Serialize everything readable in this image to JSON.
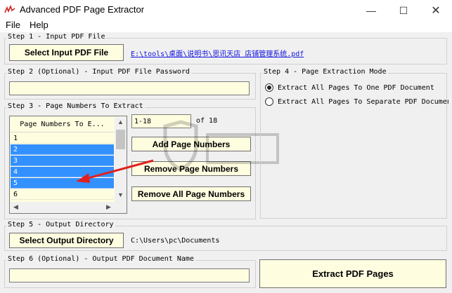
{
  "window": {
    "title": "Advanced PDF Page Extractor",
    "minimize": "—",
    "maximize": "☐",
    "close": "✕"
  },
  "menu": {
    "file": "File",
    "help": "Help"
  },
  "step1": {
    "label": "Step 1 - Input PDF File",
    "button": "Select Input PDF File",
    "file_path": "E:\\tools\\桌面\\说明书\\思讯天店 店铺管理系统.pdf"
  },
  "step2": {
    "label": "Step 2 (Optional) - Input PDF File Password",
    "value": ""
  },
  "step3": {
    "label": "Step 3 - Page Numbers To Extract",
    "list_header": "Page Numbers To E...",
    "rows": [
      {
        "text": "1",
        "selected": false
      },
      {
        "text": "2",
        "selected": true
      },
      {
        "text": "3",
        "selected": true
      },
      {
        "text": "4",
        "selected": true
      },
      {
        "text": "5",
        "selected": true
      },
      {
        "text": "6",
        "selected": false
      }
    ],
    "range_value": "1-18",
    "of_total": "of 18",
    "add_button": "Add Page Numbers",
    "remove_button": "Remove Page Numbers",
    "remove_all_button": "Remove All Page Numbers"
  },
  "step4": {
    "label": "Step 4 - Page Extraction Mode",
    "option_one": "Extract All Pages To One PDF Document",
    "option_separate": "Extract All Pages To Separate PDF Documen",
    "selected": "one"
  },
  "step5": {
    "label": "Step 5 - Output Directory",
    "button": "Select Output Directory",
    "path": "C:\\Users\\pc\\Documents"
  },
  "step6": {
    "label": "Step 6 (Optional) - Output PDF Document Name",
    "value": ""
  },
  "extract_button": "Extract PDF Pages",
  "colors": {
    "field_bg": "#fffde0",
    "selection": "#3390ff",
    "link": "#1010e0",
    "arrow": "#e02020"
  }
}
